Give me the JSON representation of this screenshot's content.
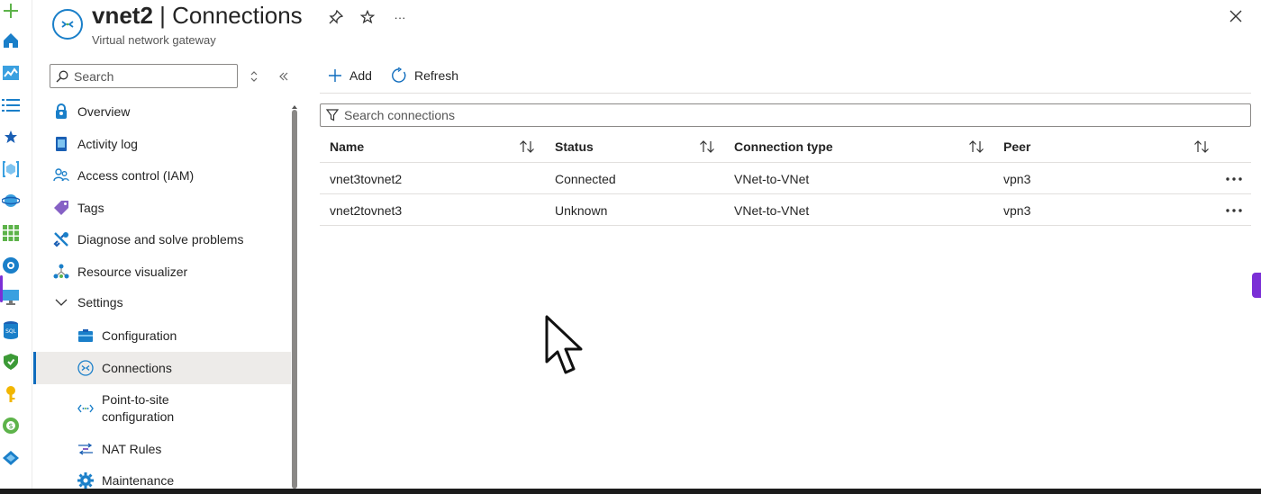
{
  "header": {
    "resource_name": "vnet2",
    "separator": " | ",
    "page_title": "Connections",
    "subtitle": "Virtual network gateway",
    "more_label": "···"
  },
  "menu": {
    "search_placeholder": "Search",
    "items": [
      {
        "label": "Overview",
        "icon": "overview-icon"
      },
      {
        "label": "Activity log",
        "icon": "activity-log-icon"
      },
      {
        "label": "Access control (IAM)",
        "icon": "people-icon"
      },
      {
        "label": "Tags",
        "icon": "tag-icon"
      },
      {
        "label": "Diagnose and solve problems",
        "icon": "wrench-icon"
      },
      {
        "label": "Resource visualizer",
        "icon": "visualizer-icon"
      },
      {
        "label": "Settings",
        "icon": "chevron-down-icon"
      },
      {
        "label": "Configuration",
        "icon": "configuration-icon"
      },
      {
        "label": "Connections",
        "icon": "connections-icon",
        "selected": true
      },
      {
        "label": "Point-to-site configuration",
        "label_line1": "Point-to-site",
        "label_line2": "configuration",
        "icon": "point-to-site-icon"
      },
      {
        "label": "NAT Rules",
        "icon": "nat-rules-icon"
      },
      {
        "label": "Maintenance",
        "icon": "gear-icon"
      }
    ]
  },
  "toolbar": {
    "add_label": "Add",
    "refresh_label": "Refresh"
  },
  "grid": {
    "filter_placeholder": "Search connections",
    "columns": [
      "Name",
      "Status",
      "Connection type",
      "Peer"
    ],
    "rows": [
      {
        "name": "vnet3tovnet2",
        "status": "Connected",
        "type": "VNet-to-VNet",
        "peer": "vpn3"
      },
      {
        "name": "vnet2tovnet3",
        "status": "Unknown",
        "type": "VNet-to-VNet",
        "peer": "vpn3"
      }
    ],
    "row_more_label": "•••"
  },
  "colors": {
    "accent": "#0f6cbd",
    "selected_bg": "#edebe9",
    "side_tab": "#7b2fd6"
  }
}
